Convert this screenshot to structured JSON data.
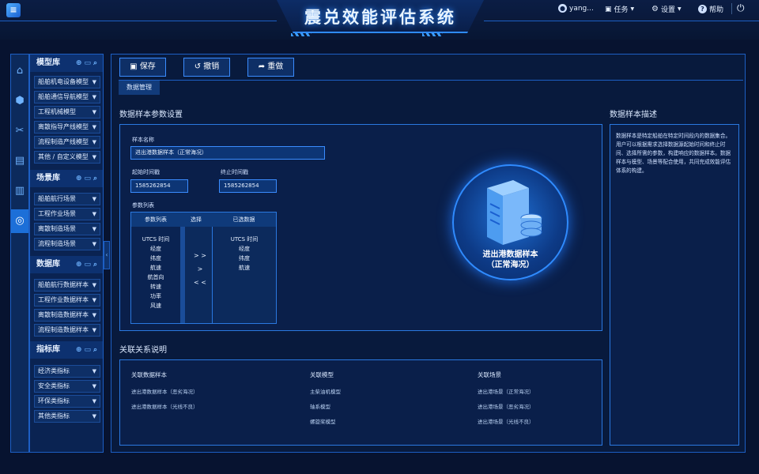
{
  "app": {
    "title": "震兑效能评估系统"
  },
  "topbar": {
    "user": "yang...",
    "tasks": "任务",
    "settings": "设置",
    "help": "帮助"
  },
  "rail": {
    "icons": [
      "home-icon",
      "cube-icon",
      "tools-icon",
      "clipboard-icon",
      "chart-icon",
      "compass-icon"
    ],
    "active": 5
  },
  "sidebar": {
    "sections": [
      {
        "title": "模型库",
        "items": [
          "船舶机电设备模型",
          "船舶通信导航模型",
          "工程机械模型",
          "离散指导产线模型",
          "流程制造产线模型",
          "其他 / 自定义模型"
        ]
      },
      {
        "title": "场景库",
        "items": [
          "船舶航行场景",
          "工程作业场景",
          "离散制造场景",
          "流程制造场景"
        ]
      },
      {
        "title": "数据库",
        "items": [
          "船舶航行数据样本",
          "工程作业数据样本",
          "离散制造数据样本",
          "流程制造数据样本"
        ]
      },
      {
        "title": "指标库",
        "items": [
          "经济类指标",
          "安全类指标",
          "环保类指标",
          "其他类指标"
        ]
      }
    ]
  },
  "toolbar": {
    "save": "保存",
    "undo": "撤销",
    "redo": "重做"
  },
  "tab": {
    "label": "数据管理"
  },
  "params": {
    "title": "数据样本参数设置",
    "name_label": "样本名称",
    "name_value": "进出港数据样本（正常海况）",
    "start_label": "起始时间戳",
    "start_value": "1585262854",
    "end_label": "终止时间戳",
    "end_value": "1585262854",
    "list_label": "参数列表",
    "col_params": "参数列表",
    "col_select": "选择",
    "col_selected": "已选数据",
    "available": [
      "UTCS 时间",
      "经度",
      "纬度",
      "航速",
      "航首向",
      "转速",
      "功率",
      "风速"
    ],
    "selected": [
      "UTCS 时间",
      "经度",
      "纬度",
      "航速"
    ],
    "btn_all_right": "> >",
    "btn_right": ">",
    "btn_all_left": "< <"
  },
  "graphic": {
    "label_line1": "进出港数据样本",
    "label_line2": "（正常海况）"
  },
  "description": {
    "title": "数据样本描述",
    "text": "数据样本是特定船舶在特定时间段内的数据集合。用户可以根据需求选择数据源起始时间和终止时间、选择所需的参数，构建响应的数据样本。数据样本与模型、场景等配合使用，共同完成效能评估体系的构建。"
  },
  "relations": {
    "title": "关联关系说明",
    "col1_title": "关联数据样本",
    "col1": [
      "进出港数据样本（恶劣海况）",
      "进出港数据样本（光线不良）"
    ],
    "col2_title": "关联模型",
    "col2": [
      "主柴油机模型",
      "轴系模型",
      "螺旋桨模型"
    ],
    "col3_title": "关联场景",
    "col3": [
      "进出港场景（正常海况）",
      "进出港场景（恶劣海况）",
      "进出港场景（光线不良）"
    ]
  }
}
